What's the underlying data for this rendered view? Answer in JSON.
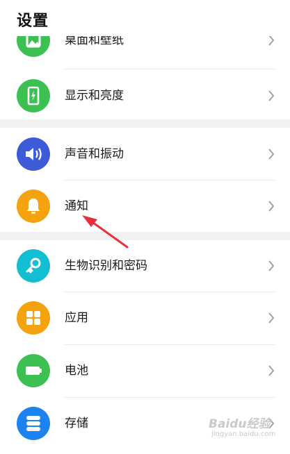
{
  "header": {
    "title": "设置"
  },
  "items": [
    {
      "label": "桌面和壁纸",
      "icon": "wallpaper-icon",
      "color": "#3cc051"
    },
    {
      "label": "显示和亮度",
      "icon": "display-brightness-icon",
      "color": "#3cc051"
    },
    {
      "label": "声音和振动",
      "icon": "sound-icon",
      "color": "#3d5bd6"
    },
    {
      "label": "通知",
      "icon": "bell-icon",
      "color": "#f5a20f"
    },
    {
      "label": "生物识别和密码",
      "icon": "key-icon",
      "color": "#12bed1"
    },
    {
      "label": "应用",
      "icon": "apps-grid-icon",
      "color": "#f5a20f"
    },
    {
      "label": "电池",
      "icon": "battery-icon",
      "color": "#3cc051"
    },
    {
      "label": "存储",
      "icon": "storage-icon",
      "color": "#1d83f0"
    }
  ],
  "annotation": {
    "arrow_color": "#e8303a",
    "points_to": "通知"
  },
  "watermark": {
    "text": "Baidu经验",
    "subtext": "jingyan.baidu.com"
  }
}
